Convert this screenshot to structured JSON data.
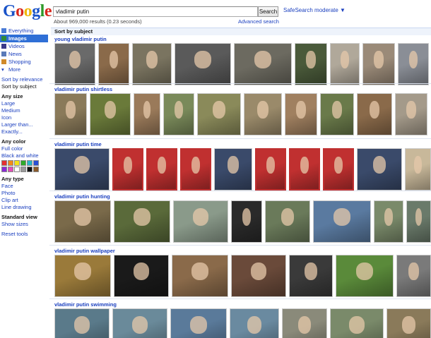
{
  "logo": {
    "text": "Google"
  },
  "search": {
    "value": "vladimir putin",
    "button": "Search"
  },
  "safesearch": "SafeSearch moderate ▼",
  "results_count": "About 969,000 results (0.23 seconds)",
  "advanced_search": "Advanced search",
  "nav": {
    "items": [
      {
        "label": "Everything",
        "icon": "everything-icon",
        "color": "#4a7bd6"
      },
      {
        "label": "Images",
        "icon": "images-icon",
        "color": "#2f8a3a"
      },
      {
        "label": "Videos",
        "icon": "videos-icon",
        "color": "#3a3a8a"
      },
      {
        "label": "News",
        "icon": "news-icon",
        "color": "#5a7ab8"
      },
      {
        "label": "Shopping",
        "icon": "shopping-icon",
        "color": "#d08a2a"
      },
      {
        "label": "More",
        "icon": "chevron-down-icon",
        "color": "#1a3fbf"
      }
    ],
    "sort": [
      "Sort by relevance",
      "Sort by subject"
    ],
    "size_title": "Any size",
    "sizes": [
      "Large",
      "Medium",
      "Icon",
      "Larger than...",
      "Exactly..."
    ],
    "color_title": "Any color",
    "colors": [
      "Full color",
      "Black and white"
    ],
    "swatches": [
      "#e53030",
      "#f28a1a",
      "#f3e21a",
      "#2faa2a",
      "#28b6c8",
      "#2a4fd6",
      "#8a2ad6",
      "#e24fb8",
      "#ffffff",
      "#9a9a9a",
      "#111111",
      "#8a5a2a"
    ],
    "type_title": "Any type",
    "types": [
      "Face",
      "Photo",
      "Clip art",
      "Line drawing"
    ],
    "view_title": "Standard view",
    "view_link": "Show sizes",
    "reset": "Reset tools"
  },
  "main": {
    "sort_header": "Sort by subject",
    "sections": [
      {
        "title": "young vladimir putin",
        "thumbs": [
          "#6a6a6a",
          "#8a6a4a",
          "#7a7460",
          "#5a5a5a",
          "#6c6a60",
          "#4a5a3a",
          "#b0a89a",
          "#9a8a78",
          "#8a8e96",
          "#7c8490",
          "#9a948c"
        ]
      },
      {
        "title": "vladimir putin shirtless",
        "thumbs": [
          "#8a7a5a",
          "#6a7a3a",
          "#9a7a5a",
          "#7a8a5a",
          "#8a8a5a",
          "#9a8a6a",
          "#a08060",
          "#6a7a4a",
          "#8a6a4a",
          "#a49a8a"
        ]
      },
      {
        "title": "vladimir putin time",
        "thumbs": [
          "#3a4a6a",
          "#c03030",
          "#c03030",
          "#c03030",
          "#3a4a6a",
          "#c03030",
          "#c03030",
          "#c03030",
          "#3a4a6a",
          "#c8b89a"
        ]
      },
      {
        "title": "vladimir putin hunting",
        "thumbs": [
          "#7a6a4a",
          "#5a6a3a",
          "#8a9a8a",
          "#2a2a2a",
          "#6a7a5a",
          "#5a7aa0",
          "#7a8a6a",
          "#6a7a6a"
        ]
      },
      {
        "title": "vladimir putin wallpaper",
        "thumbs": [
          "#9a7a3a",
          "#1a1a1a",
          "#8a6a4a",
          "#6a4a3a",
          "#3a3a3a",
          "#5a8a3a",
          "#7a7a7a"
        ]
      },
      {
        "title": "vladimir putin swimming",
        "thumbs": [
          "#5a7a8a",
          "#6a8a9a",
          "#5a7a9a",
          "#6a8aa0",
          "#8a8a7a",
          "#7a8a6a",
          "#8a7a5a"
        ]
      }
    ]
  }
}
